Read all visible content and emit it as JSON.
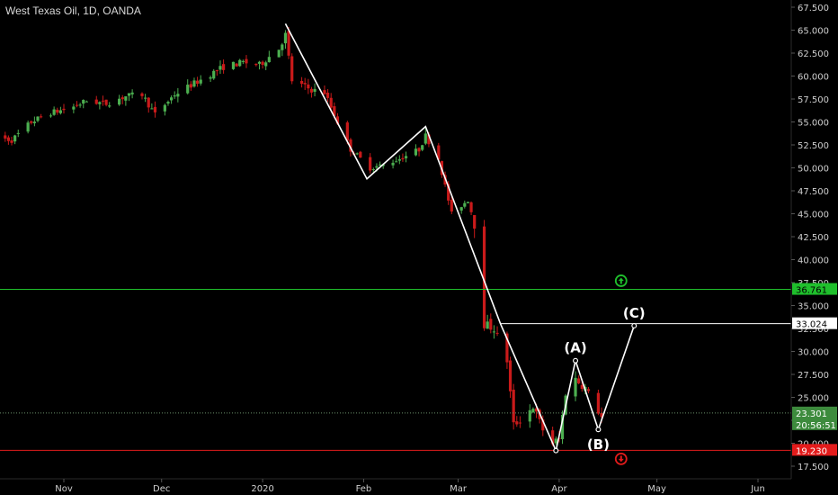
{
  "header": {
    "title": "West Texas Oil, 1D, OANDA"
  },
  "colors": {
    "background": "#000000",
    "up_candle": "#4caf50",
    "down_candle": "#c91a1a",
    "resistance_line": "#1fbf2c",
    "support_line": "#e31b1b",
    "wave_line": "#ffffff",
    "axis_text": "#cfcfcf",
    "current_price_badge": "#3d8b3d"
  },
  "chart_data": {
    "type": "candlestick",
    "title": "West Texas Oil, 1D, OANDA",
    "y_axis": {
      "position": "right",
      "min": 17.5,
      "max": 67.5,
      "tick_labels": [
        "67.500",
        "65.000",
        "62.500",
        "60.000",
        "57.500",
        "55.000",
        "52.500",
        "50.000",
        "47.500",
        "45.000",
        "42.500",
        "40.000",
        "37.500",
        "35.000",
        "32.500",
        "30.000",
        "27.500",
        "25.000",
        "22.500",
        "20.000",
        "17.500"
      ]
    },
    "x_axis": {
      "tick_labels": [
        {
          "label": "Nov",
          "date": "2019-11-01"
        },
        {
          "label": "Dec",
          "date": "2019-12-01"
        },
        {
          "label": "2020",
          "date": "2020-01-01"
        },
        {
          "label": "Feb",
          "date": "2020-02-01"
        },
        {
          "label": "Mar",
          "date": "2020-03-01"
        },
        {
          "label": "Apr",
          "date": "2020-04-01"
        },
        {
          "label": "May",
          "date": "2020-05-01"
        },
        {
          "label": "Jun",
          "date": "2020-06-01"
        }
      ]
    },
    "price_path": [
      [
        "2019-10-10",
        53.5
      ],
      [
        "2019-10-16",
        53.0
      ],
      [
        "2019-10-22",
        55.0
      ],
      [
        "2019-10-28",
        56.0
      ],
      [
        "2019-11-03",
        56.5
      ],
      [
        "2019-11-08",
        57.3
      ],
      [
        "2019-11-14",
        57.0
      ],
      [
        "2019-11-20",
        57.8
      ],
      [
        "2019-11-25",
        58.0
      ],
      [
        "2019-11-29",
        55.8
      ],
      [
        "2019-12-05",
        58.0
      ],
      [
        "2019-12-10",
        59.0
      ],
      [
        "2019-12-16",
        60.2
      ],
      [
        "2019-12-20",
        61.0
      ],
      [
        "2019-12-26",
        61.5
      ],
      [
        "2019-12-31",
        61.2
      ],
      [
        "2020-01-06",
        63.0
      ],
      [
        "2020-01-08",
        64.5
      ],
      [
        "2020-01-10",
        59.5
      ],
      [
        "2020-01-16",
        58.5
      ],
      [
        "2020-01-20",
        58.2
      ],
      [
        "2020-01-24",
        55.0
      ],
      [
        "2020-01-28",
        52.0
      ],
      [
        "2020-02-03",
        50.0
      ],
      [
        "2020-02-07",
        50.3
      ],
      [
        "2020-02-12",
        51.0
      ],
      [
        "2020-02-18",
        52.0
      ],
      [
        "2020-02-20",
        53.5
      ],
      [
        "2020-02-24",
        51.0
      ],
      [
        "2020-02-28",
        45.0
      ],
      [
        "2020-03-04",
        46.5
      ],
      [
        "2020-03-06",
        44.0
      ],
      [
        "2020-03-09",
        33.0
      ],
      [
        "2020-03-12",
        32.5
      ],
      [
        "2020-03-16",
        29.0
      ],
      [
        "2020-03-18",
        22.0
      ],
      [
        "2020-03-20",
        22.5
      ],
      [
        "2020-03-24",
        24.0
      ],
      [
        "2020-03-27",
        21.5
      ],
      [
        "2020-03-30",
        20.0
      ],
      [
        "2020-04-01",
        20.5
      ],
      [
        "2020-04-03",
        25.5
      ],
      [
        "2020-04-06",
        27.0
      ],
      [
        "2020-04-09",
        26.0
      ],
      [
        "2020-04-13",
        23.5
      ],
      [
        "2020-04-14",
        22.8
      ]
    ],
    "wave_lines": [
      [
        [
          "2020-01-08",
          65.7
        ],
        [
          "2020-02-02",
          48.8
        ],
        [
          "2020-02-20",
          54.5
        ],
        [
          "2020-03-14",
          33.0
        ],
        [
          "2020-03-31",
          19.2
        ],
        [
          "2020-04-06",
          29.0
        ],
        [
          "2020-04-13",
          21.5
        ],
        [
          "2020-04-24",
          32.8
        ]
      ]
    ],
    "horizontal_levels": [
      {
        "value": 36.761,
        "label": "36.761",
        "color": "#1fbf2c",
        "from": "start"
      },
      {
        "value": 33.024,
        "label": "33.024",
        "color": "#ffffff",
        "from": "2020-03-14"
      },
      {
        "value": 19.23,
        "label": "19.230",
        "color": "#e31b1b",
        "from": "start"
      }
    ],
    "current_price": {
      "value": 23.301,
      "label": "23.301",
      "countdown": "20:56:51"
    },
    "annotations": [
      {
        "text": "(A)",
        "date": "2020-04-06",
        "value": 29.0,
        "position": "above"
      },
      {
        "text": "(B)",
        "date": "2020-04-13",
        "value": 21.5,
        "position": "below"
      },
      {
        "text": "(C)",
        "date": "2020-04-24",
        "value": 32.8,
        "position": "above"
      }
    ],
    "markers": [
      {
        "type": "up-arrow-circle",
        "date": "2020-04-20",
        "value": 37.7,
        "color": "#1fbf2c"
      },
      {
        "type": "down-arrow-circle",
        "date": "2020-04-20",
        "value": 18.3,
        "color": "#e31b1b"
      }
    ]
  }
}
